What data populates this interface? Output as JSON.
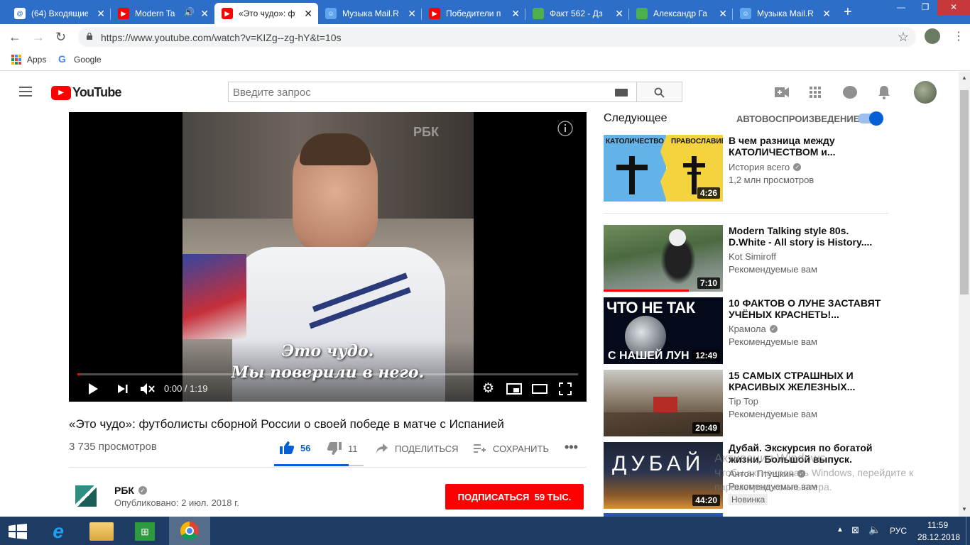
{
  "browser": {
    "tabs": [
      {
        "label": "(64) Входящие",
        "icon": "mail-icon",
        "color": "#2a6fd6"
      },
      {
        "label": "Modern Ta",
        "icon": "youtube-icon",
        "color": "#ff0000"
      },
      {
        "label": "«Это чудо»: фу",
        "icon": "youtube-icon",
        "color": "#ff0000"
      },
      {
        "label": "Музыка Mail.Ru",
        "icon": "mailru-icon",
        "color": "#2a6fd6"
      },
      {
        "label": "Победители п",
        "icon": "youtube-icon",
        "color": "#ff0000"
      },
      {
        "label": "Факт 562 - Дз",
        "icon": "zen-icon",
        "color": "#4caf50"
      },
      {
        "label": "Александр Га",
        "icon": "zen-icon",
        "color": "#4caf50"
      },
      {
        "label": "Музыка Mail.R",
        "icon": "mailru-icon",
        "color": "#2a6fd6"
      }
    ],
    "url": "https://www.youtube.com/watch?v=KIZg--zg-hY&t=10s",
    "bookmarks": [
      "Apps",
      "Google"
    ]
  },
  "youtube": {
    "logo": "YouTube",
    "search_placeholder": "Введите запрос",
    "video": {
      "title": "«Это чудо»: футболисты сборной России о своей победе в матче с Испанией",
      "views": "3 735 просмотров",
      "likes": "56",
      "dislikes": "11",
      "share": "ПОДЕЛИТЬСЯ",
      "save": "СОХРАНИТЬ",
      "time": "0:00 / 1:19",
      "subtitle_line1": "Это чудо.",
      "subtitle_line2": "Мы поверили в него.",
      "watermark": "РБК",
      "progress_fraction": 0.005
    },
    "channel": {
      "name": "РБК",
      "published": "Опубликовано: 2 июл. 2018 г.",
      "subscribe_label": "ПОДПИСАТЬСЯ",
      "subscribers": "59 ТЫС."
    },
    "sidebar": {
      "next_label": "Следующее",
      "autoplay_label": "АВТОВОСПРОИЗВЕДЕНИЕ",
      "items": [
        {
          "title1": "В чем разница между",
          "title2": "КАТОЛИЧЕСТВОМ и...",
          "channel": "История всего",
          "meta": "1,2 млн просмотров",
          "duration": "4:26",
          "thumb_left": "КАТОЛИЧЕСТВО",
          "thumb_right": "ПРАВОСЛАВИЕ"
        },
        {
          "title1": "Modern Talking style 80s.",
          "title2": "D.White - All story is History....",
          "channel": "Kot Simiroff",
          "meta": "Рекомендуемые вам",
          "duration": "7:10"
        },
        {
          "title1": "10 ФАКТОВ О ЛУНЕ ЗАСТАВЯТ",
          "title2": "УЧЁНЫХ КРАСНЕТЬ!...",
          "channel": "Крамола",
          "meta": "Рекомендуемые вам",
          "duration": "12:49",
          "thumb_top": "ЧТО НЕ ТАК",
          "thumb_bottom": "С НАШЕЙ ЛУН"
        },
        {
          "title1": "15 САМЫХ СТРАШНЫХ И",
          "title2": "КРАСИВЫХ ЖЕЛЕЗНЫХ...",
          "channel": "Tip Top",
          "meta": "Рекомендуемые вам",
          "duration": "20:49"
        },
        {
          "title1": "Дубай. Экскурсия по богатой",
          "title2": "жизни. Большой выпуск.",
          "channel": "Антон Птушкин",
          "meta": "Рекомендуемые вам",
          "duration": "44:20",
          "badge": "Новинка",
          "thumb_text": "ДУБАЙ"
        }
      ]
    }
  },
  "watermark": {
    "line1": "Активация Windows",
    "line2": "Чтобы активировать Windows, перейдите к",
    "line3": "параметрам компьютера."
  },
  "taskbar": {
    "lang": "РУС",
    "time": "11:59",
    "date": "28.12.2018"
  }
}
